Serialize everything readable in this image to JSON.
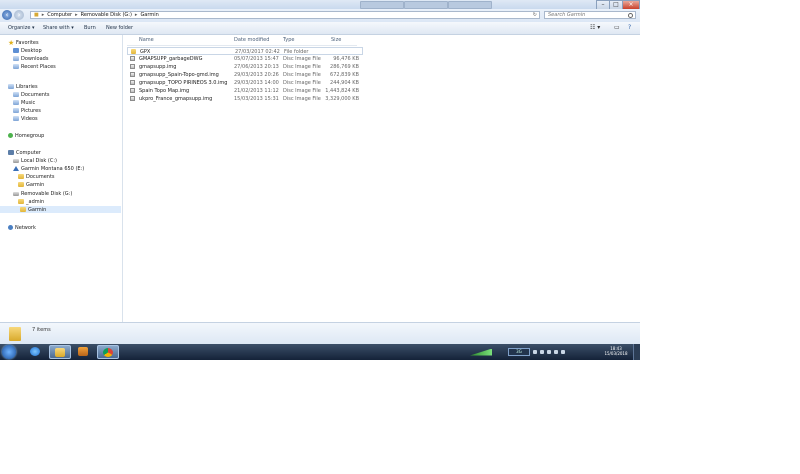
{
  "window": {
    "minimize_glyph": "–",
    "maximize_glyph": "□",
    "close_glyph": "×"
  },
  "address": {
    "crumbs": [
      "Computer",
      "Removable Disk (G:)",
      "Garmin"
    ],
    "separator": "▸",
    "refresh_glyph": "↻"
  },
  "search": {
    "placeholder": "Search Garmin"
  },
  "toolbar": {
    "organize": "Organize ▾",
    "share_with": "Share with ▾",
    "burn": "Burn",
    "new_folder": "New folder",
    "view_glyph": "☷ ▾",
    "help_glyph": "?"
  },
  "sidebar": {
    "favorites": "Favorites",
    "desktop": "Desktop",
    "downloads": "Downloads",
    "recent_places": "Recent Places",
    "libraries": "Libraries",
    "documents": "Documents",
    "music": "Music",
    "pictures": "Pictures",
    "videos": "Videos",
    "homegroup": "Homegroup",
    "computer": "Computer",
    "local_disk": "Local Disk (C:)",
    "garmin_device": "Garmin Montana 650 (E:)",
    "garmin_documents": "Documents",
    "garmin_garmin": "Garmin",
    "removable_disk": "Removable Disk (G:)",
    "admin": "_admin",
    "garmin_selected": "Garmin",
    "network": "Network"
  },
  "columns": {
    "name": "Name",
    "date": "Date modified",
    "type": "Type",
    "size": "Size"
  },
  "files": [
    {
      "name": "GPX",
      "date": "27/03/2017 02:42",
      "type": "File folder",
      "size": "",
      "kind": "folder"
    },
    {
      "name": "GMAPSUPP_garbageDWG",
      "date": "05/07/2013 15:47",
      "type": "Disc Image File",
      "size": "96,476 KB",
      "kind": "image"
    },
    {
      "name": "gmapsupp.img",
      "date": "27/06/2013 20:13",
      "type": "Disc Image File",
      "size": "286,769 KB",
      "kind": "image"
    },
    {
      "name": "gmapsupp_Spain-Topo-gmd.img",
      "date": "29/03/2013 20:26",
      "type": "Disc Image File",
      "size": "672,839 KB",
      "kind": "image"
    },
    {
      "name": "gmapsupp_TOPO PIRINEOS 3.0.img",
      "date": "29/03/2013 14:00",
      "type": "Disc Image File",
      "size": "244,904 KB",
      "kind": "image"
    },
    {
      "name": "Spain Topo Map.img",
      "date": "21/02/2013 11:12",
      "type": "Disc Image File",
      "size": "1,443,824 KB",
      "kind": "image"
    },
    {
      "name": "ukpro_France_gmapsupp.img",
      "date": "15/03/2013 15:31",
      "type": "Disc Image File",
      "size": "3,329,000 KB",
      "kind": "image"
    }
  ],
  "details": {
    "item_count": "7 items"
  },
  "taskbar": {
    "tray_label": "3G",
    "time": "18:43",
    "date": "15/03/2018"
  },
  "colors": {
    "taskbar": "#142238",
    "selection": "#dcebfc",
    "folder": "#e2b53a"
  }
}
